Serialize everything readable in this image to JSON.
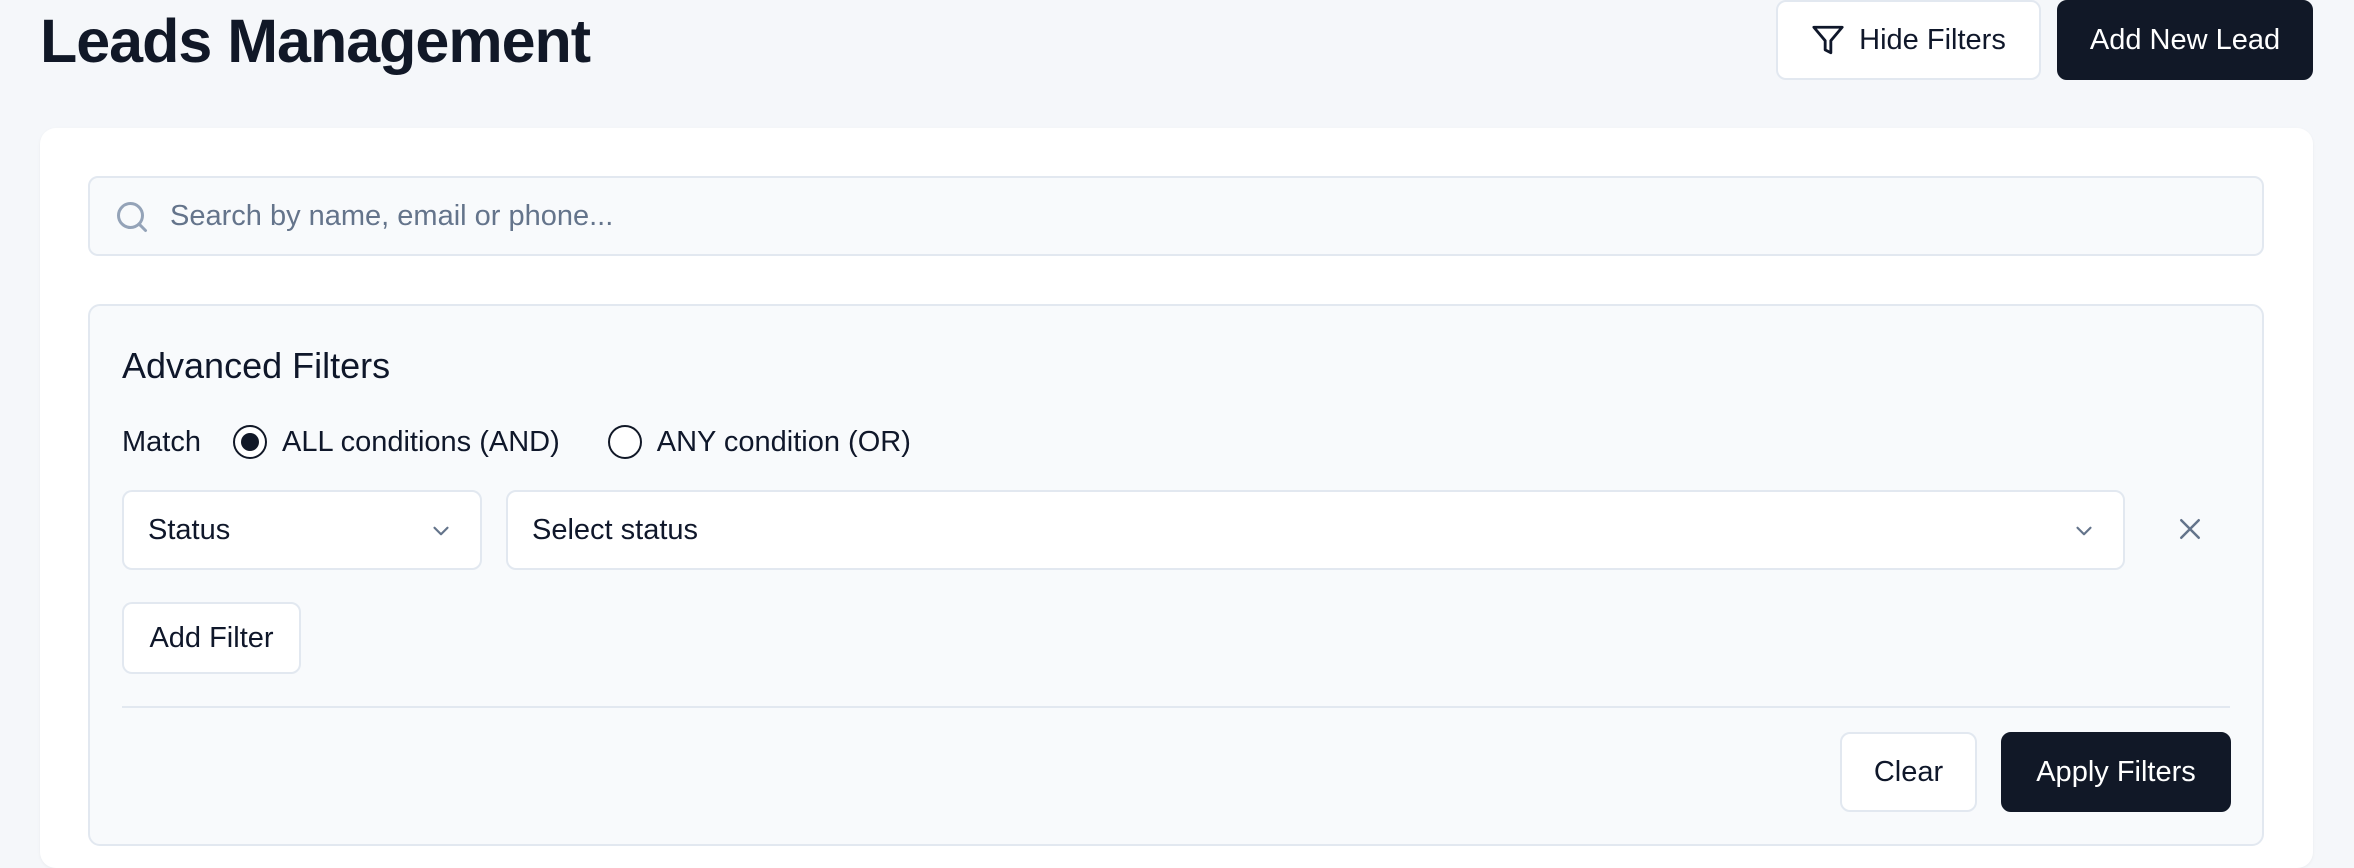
{
  "header": {
    "title": "Leads Management",
    "hide_filters_label": "Hide Filters",
    "hide_filters_icon": "filter-icon",
    "add_new_lead_label": "Add New Lead"
  },
  "search": {
    "placeholder": "Search by name, email or phone...",
    "value": "",
    "icon": "search-icon"
  },
  "advanced_filters": {
    "title": "Advanced Filters",
    "match_label": "Match",
    "match_options": [
      {
        "label": "ALL conditions (AND)",
        "selected": true
      },
      {
        "label": "ANY condition (OR)",
        "selected": false
      }
    ],
    "rows": [
      {
        "field": "Status",
        "value_placeholder": "Select status"
      }
    ],
    "add_filter_label": "Add Filter",
    "clear_label": "Clear",
    "apply_label": "Apply Filters"
  },
  "colors": {
    "background": "#f5f7fa",
    "primary_dark": "#111827",
    "border": "#e2e8f0",
    "panel_bg": "#f8fafc"
  }
}
